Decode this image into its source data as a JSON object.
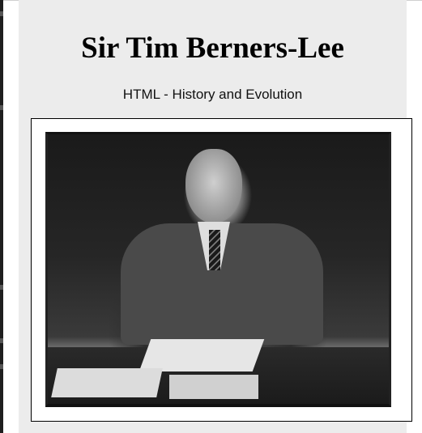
{
  "page": {
    "title": "Sir Tim Berners-Lee",
    "subtitle": "HTML - History and Evolution"
  },
  "photo": {
    "icon": "portrait-photo",
    "description_visible": false
  },
  "colors": {
    "panel_background": "#ececec",
    "page_background": "#ffffff",
    "frame_border": "#000000",
    "sidebar": "#1e1e1e"
  }
}
